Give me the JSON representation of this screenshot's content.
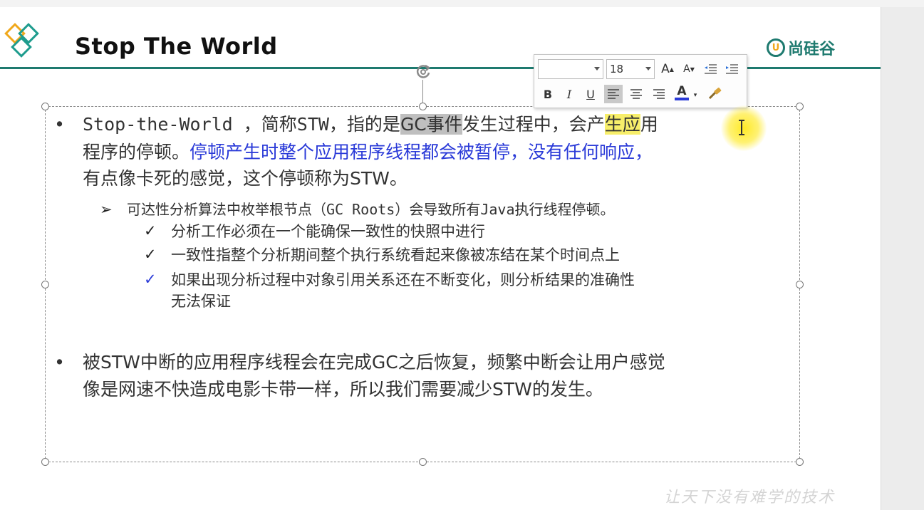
{
  "header": {
    "title": "Stop The World",
    "brand_mark": "U",
    "brand_text": "尚硅谷"
  },
  "toolbar": {
    "font_name": "",
    "font_size": "18",
    "grow_font": "A",
    "shrink_font": "A",
    "bold": "B",
    "italic": "I",
    "underline": "U",
    "font_color": "A"
  },
  "content": {
    "bullet1": {
      "part_a": "Stop-the-World ，简称STW，指的是",
      "part_gc": "GC事件",
      "part_b": "发生过程中，会产",
      "part_hl": "生应",
      "part_c": "用",
      "line2_plain": "程序的停顿。",
      "line2_blue": "停顿产生时整个应用程序线程都会被暂停，没有任何响应，",
      "line3": "有点像卡死的感觉，这个停顿称为STW。"
    },
    "sub_arrow": "可达性分析算法中枚举根节点（GC Roots）会导致所有Java执行线程停顿。",
    "checks": [
      "分析工作必须在一个能确保一致性的快照中进行",
      "一致性指整个分析期间整个执行系统看起来像被冻结在某个时间点上",
      "如果出现分析过程中对象引用关系还在不断变化，则分析结果的准确性",
      "无法保证"
    ],
    "bullet2": {
      "line1": "被STW中断的应用程序线程会在完成GC之后恢复，频繁中断会让用户感觉",
      "line2": "像是网速不快造成电影卡带一样，所以我们需要减少STW的发生。"
    }
  },
  "watermark": "让天下没有难学的技术",
  "colors": {
    "accent": "#1e7a6f",
    "brand_orange": "#f0a81c",
    "highlight_blue": "#2a3ad8",
    "selection_gray": "#bfbfbf",
    "cursor_yellow": "#f7ee6a"
  }
}
